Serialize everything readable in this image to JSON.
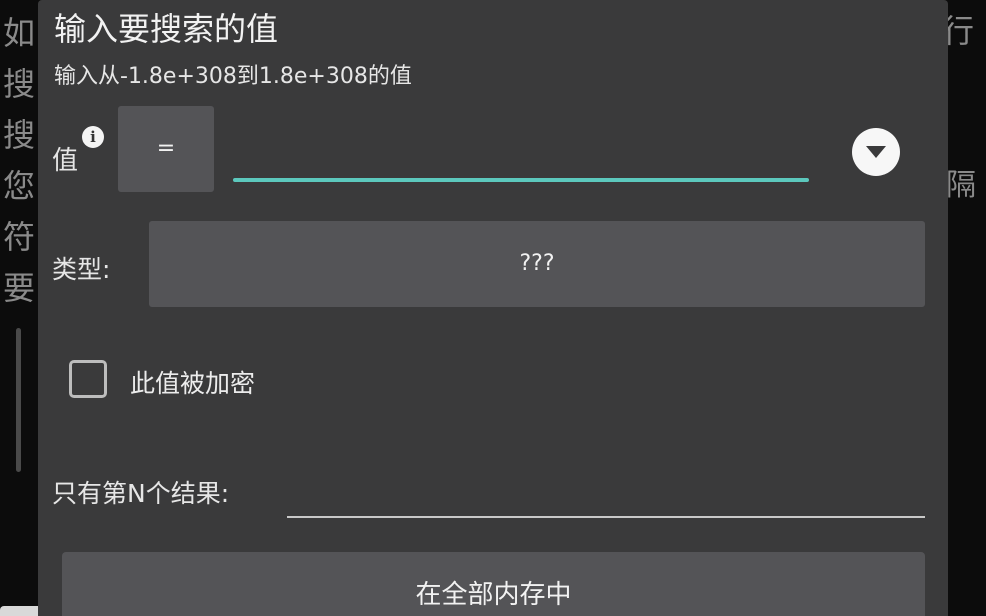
{
  "background": {
    "left_chars": [
      "如",
      "搜",
      "搜",
      "您",
      "符",
      "要"
    ],
    "right_top_char": "行",
    "right_mid_char": "隔"
  },
  "dialog": {
    "title": "输入要搜索的值",
    "subtitle": "输入从-1.8e+308到1.8e+308的值",
    "value_label": "值",
    "info_icon_glyph": "i",
    "operator": "=",
    "value_input": {
      "value": "",
      "placeholder": ""
    },
    "accent_color": "#5cc8bd",
    "type_label": "类型:",
    "type_value": "???",
    "encrypted_checkbox": {
      "label": "此值被加密",
      "checked": false
    },
    "nth_label": "只有第N个结果:",
    "nth_input": {
      "value": "",
      "placeholder": ""
    },
    "memory_button": "在全部内存中"
  }
}
